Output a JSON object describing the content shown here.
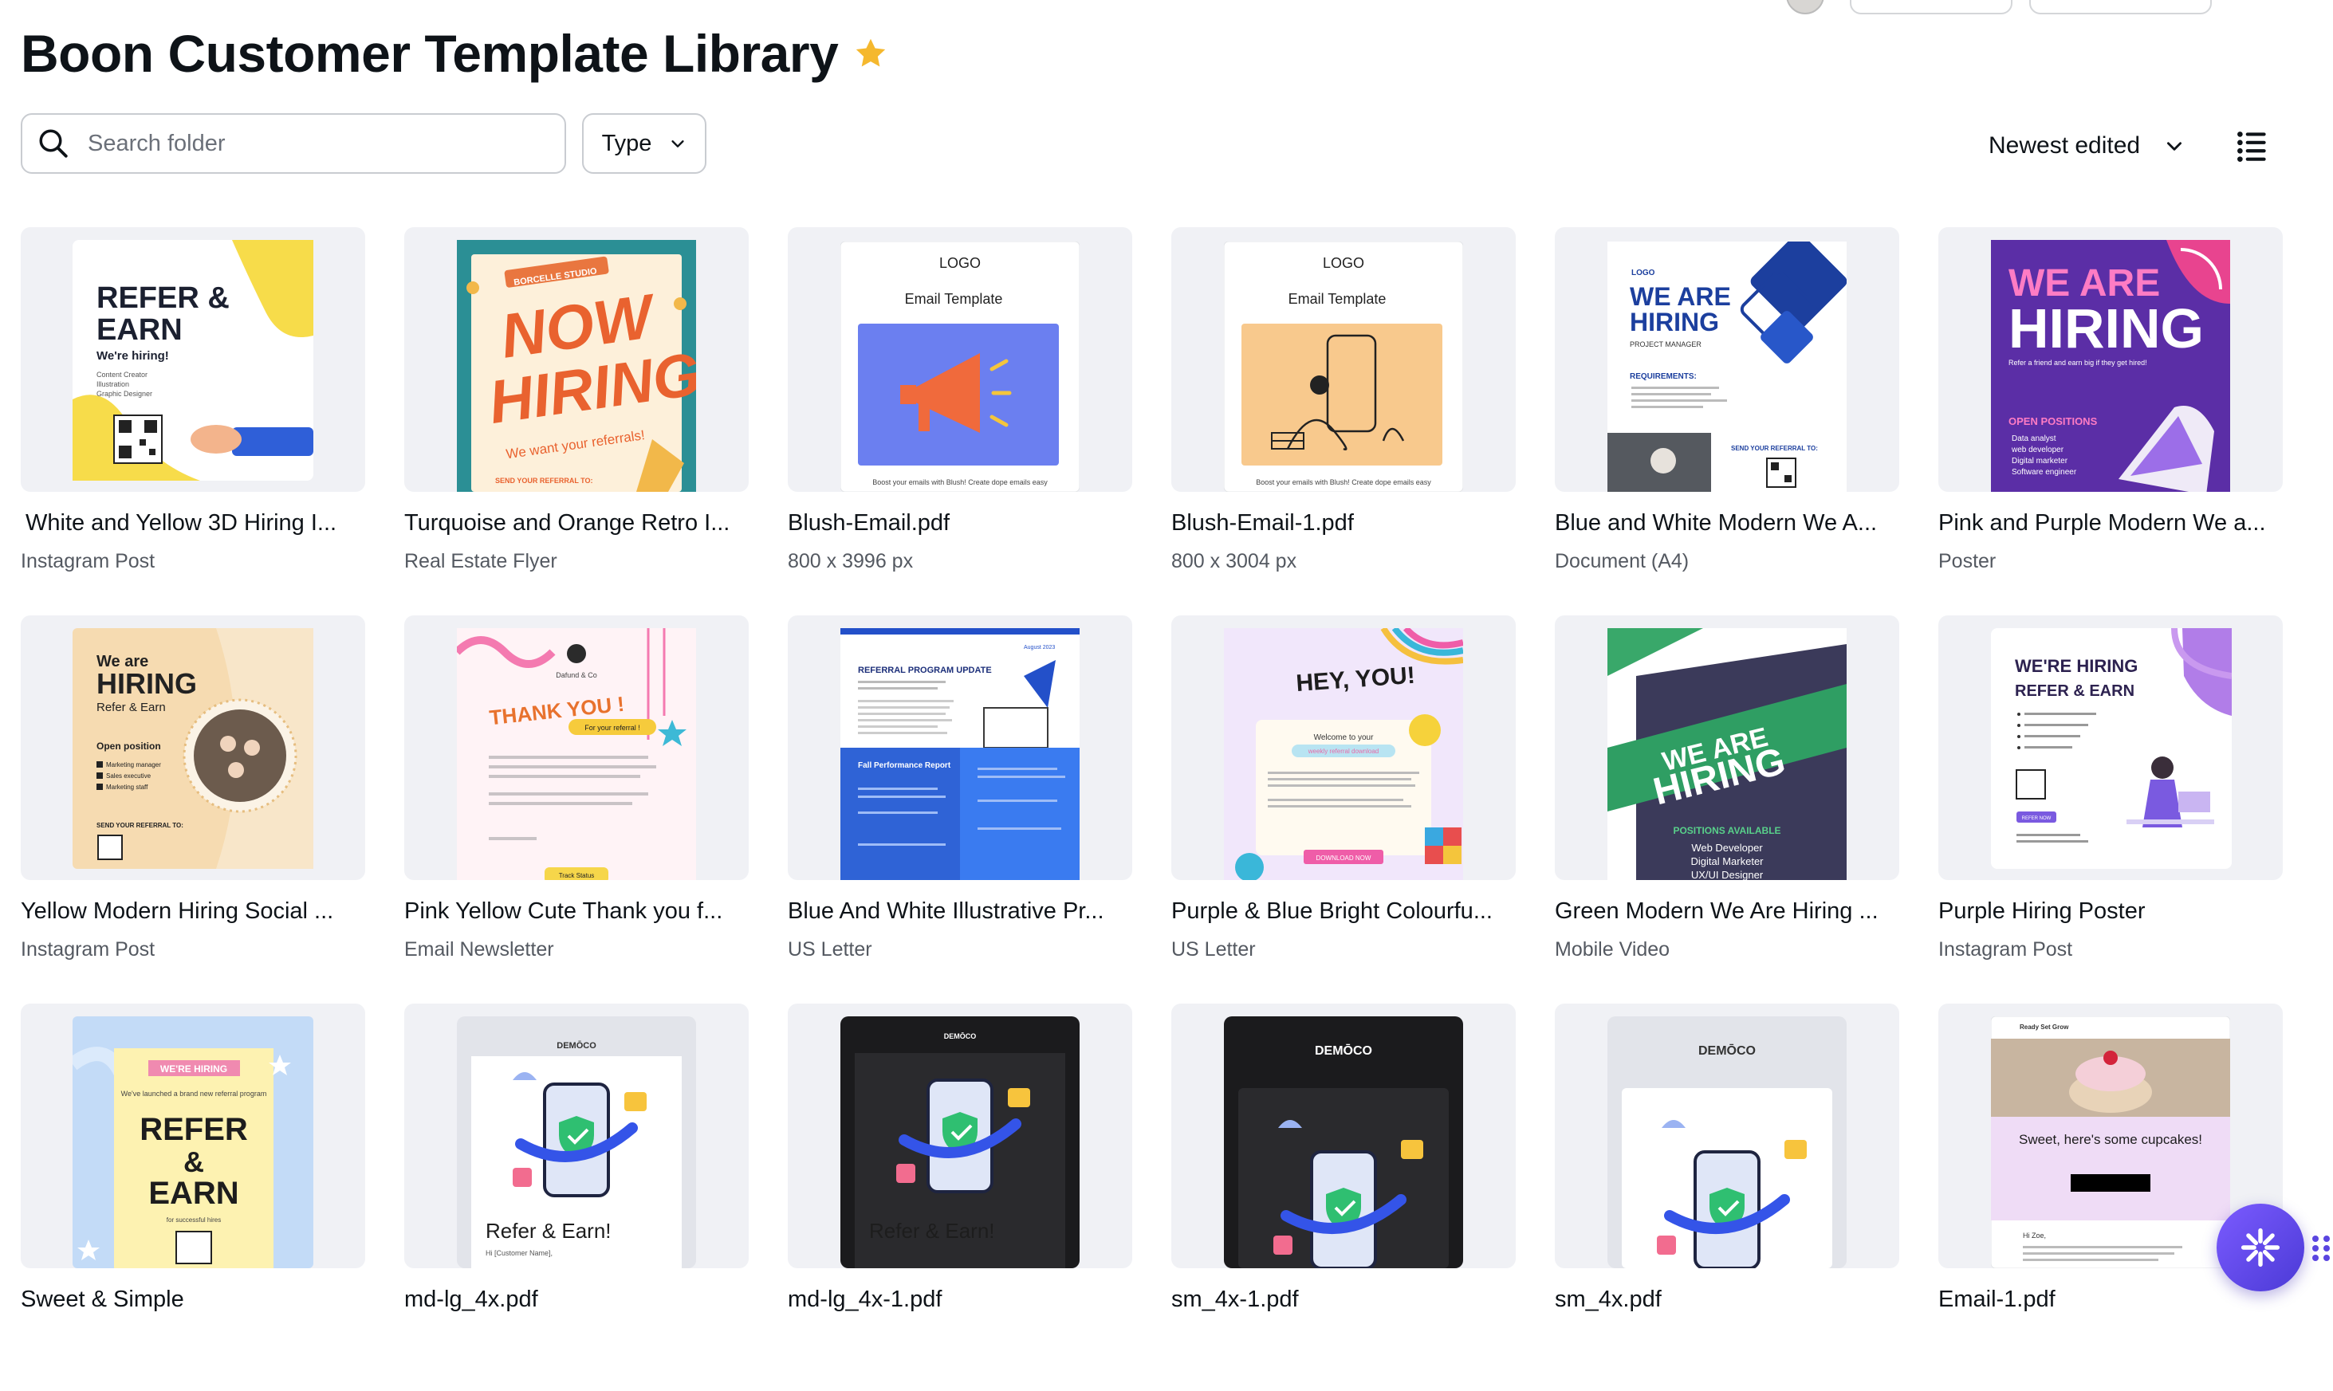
{
  "page": {
    "title": "Boon Customer Template Library"
  },
  "toolbar": {
    "search_placeholder": "Search folder",
    "type_label": "Type",
    "sort_label": "Newest edited"
  },
  "thumb_text": {
    "t0": [
      "REFER &",
      "EARN",
      "We're hiring!",
      "Content Creator",
      "Illustration",
      "Graphic Designer"
    ],
    "t1": [
      "BORCELLE STUDIO",
      "NOW",
      "HIRING",
      "We want your referrals!",
      "SEND YOUR REFERRAL TO:"
    ],
    "t2": [
      "LOGO",
      "Email Template",
      "Boost your emails with Blush! Create dope emails easy"
    ],
    "t3": [
      "LOGO",
      "Email Template",
      "Boost your emails with Blush! Create dope emails easy"
    ],
    "t4": [
      "LOGO",
      "WE ARE",
      "HIRING",
      "PROJECT MANAGER",
      "REQUIREMENTS:",
      "SEND YOUR REFERRAL TO:"
    ],
    "t5": [
      "WE ARE",
      "HIRING",
      "Refer a friend and earn big if they get hired!",
      "OPEN POSITIONS",
      "Data analyst",
      "web developer",
      "Digital marketer",
      "Software engineer"
    ],
    "t6": [
      "We are",
      "HIRING",
      "Refer & Earn",
      "Open position",
      "Marketing manager",
      "Sales executive",
      "Marketing staff",
      "SEND YOUR REFERRAL TO:"
    ],
    "t7": [
      "Dafund & Co",
      "THANK YOU !",
      "For your referral !",
      "Track Status"
    ],
    "t8": [
      "REFERRAL PROGRAM UPDATE",
      "Fall Performance Report",
      "August 2023"
    ],
    "t9": [
      "HEY, YOU!",
      "Welcome to your",
      "weekly referral download",
      "DOWNLOAD NOW"
    ],
    "t10": [
      "WE ARE",
      "HIRING",
      "POSITIONS AVAILABLE",
      "Web Developer",
      "Digital Marketer",
      "UX/UI Designer"
    ],
    "t11": [
      "WE'RE HIRING",
      "REFER & EARN",
      "REFER NOW"
    ],
    "t12": [
      "WE'RE HIRING",
      "We've launched a brand new referral program",
      "REFER",
      "&",
      "EARN",
      "for successful hires"
    ],
    "t13": [
      "DEMŌCO",
      "Refer & Earn!",
      "Hi [Customer Name],"
    ],
    "t14": [
      "DEMŌCO",
      "Refer & Earn!"
    ],
    "t15": [
      "DEMŌCO"
    ],
    "t16": [
      "DEMŌCO"
    ],
    "t17": [
      "Ready Set Grow",
      "Sweet, here's some cupcakes!",
      "Hi Zoe,"
    ]
  },
  "cards": [
    {
      "name": "White and Yellow 3D Hiring I...",
      "sub": "Instagram Post"
    },
    {
      "name": "Turquoise and Orange Retro I...",
      "sub": "Real Estate Flyer"
    },
    {
      "name": "Blush-Email.pdf",
      "sub": "800 x 3996 px"
    },
    {
      "name": "Blush-Email-1.pdf",
      "sub": "800 x 3004 px"
    },
    {
      "name": "Blue and White Modern We A...",
      "sub": "Document (A4)"
    },
    {
      "name": "Pink and Purple Modern We a...",
      "sub": "Poster"
    },
    {
      "name": "Yellow Modern Hiring Social ...",
      "sub": "Instagram Post"
    },
    {
      "name": "Pink Yellow Cute Thank you f...",
      "sub": "Email Newsletter"
    },
    {
      "name": "Blue And White Illustrative Pr...",
      "sub": "US Letter"
    },
    {
      "name": "Purple & Blue Bright Colourfu...",
      "sub": "US Letter"
    },
    {
      "name": "Green Modern We Are Hiring ...",
      "sub": "Mobile Video"
    },
    {
      "name": "Purple Hiring Poster",
      "sub": "Instagram Post"
    },
    {
      "name": "Sweet & Simple",
      "sub": ""
    },
    {
      "name": "md-lg_4x.pdf",
      "sub": ""
    },
    {
      "name": "md-lg_4x-1.pdf",
      "sub": ""
    },
    {
      "name": "sm_4x-1.pdf",
      "sub": ""
    },
    {
      "name": "sm_4x.pdf",
      "sub": ""
    },
    {
      "name": "Email-1.pdf",
      "sub": ""
    }
  ],
  "colors": {
    "accent": "#7d2ae8",
    "star": "#f5b82e",
    "fab": "#6a4cf0"
  }
}
